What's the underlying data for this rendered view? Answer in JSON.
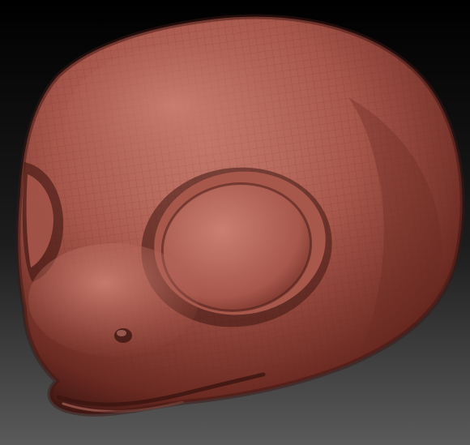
{
  "scene": {
    "subject": "sculpted-head",
    "colors": {
      "background_top": "#000000",
      "background_bottom": "#5a5a5a",
      "clay_light": "#c97f72",
      "clay_mid": "#a8574b",
      "clay_dark": "#6b2a22",
      "clay_shadow": "#3d1511",
      "wire": "#5a2019"
    }
  }
}
